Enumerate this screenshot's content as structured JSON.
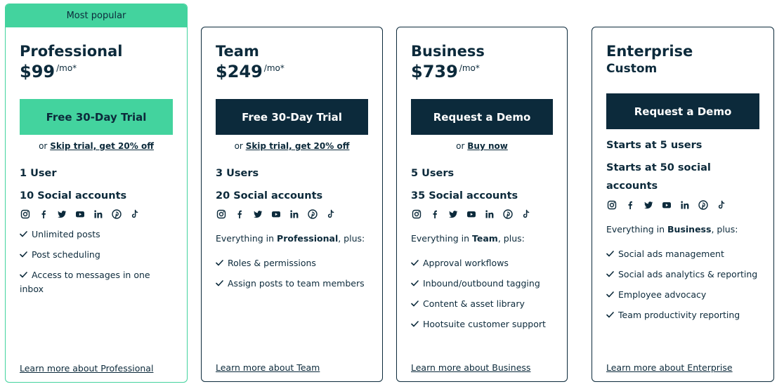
{
  "colors": {
    "brand_green": "#43d39e",
    "navy": "#0c2a3b",
    "white": "#ffffff"
  },
  "plans": {
    "professional": {
      "badge": "Most popular",
      "name": "Professional",
      "price": "$99",
      "per": "/mo*",
      "cta": "Free 30-Day Trial",
      "alt_prefix": "or",
      "alt_link": "Skip trial, get 20% off",
      "users": "1 User",
      "accounts": "10 Social accounts",
      "features": [
        "Unlimited posts",
        "Post scheduling",
        "Access to messages in one inbox"
      ],
      "learn_more": "Learn more about Professional"
    },
    "team": {
      "name": "Team",
      "price": "$249",
      "per": "/mo*",
      "cta": "Free 30-Day Trial",
      "alt_prefix": "or",
      "alt_link": "Skip trial, get 20% off",
      "users": "3 Users",
      "accounts": "20 Social accounts",
      "plus_prefix": "Everything in",
      "plus_plan": "Professional",
      "plus_suffix": ", plus:",
      "features": [
        "Roles & permissions",
        "Assign posts to team members"
      ],
      "learn_more": "Learn more about Team"
    },
    "business": {
      "name": "Business",
      "price": "$739",
      "per": "/mo*",
      "cta": "Request a Demo",
      "alt_prefix": "or",
      "alt_link": "Buy now",
      "users": "5 Users",
      "accounts": "35 Social accounts",
      "plus_prefix": "Everything in",
      "plus_plan": "Team",
      "plus_suffix": ", plus:",
      "features": [
        "Approval workflows",
        "Inbound/outbound tagging",
        "Content & asset library",
        "Hootsuite customer support"
      ],
      "learn_more": "Learn more about Business"
    },
    "enterprise": {
      "name": "Enterprise",
      "subtitle": "Custom",
      "cta": "Request a Demo",
      "users": "Starts at 5 users",
      "accounts": "Starts at 50 social accounts",
      "plus_prefix": "Everything in",
      "plus_plan": "Business",
      "plus_suffix": ", plus:",
      "features": [
        "Social ads management",
        "Social ads analytics & reporting",
        "Employee advocacy",
        "Team productivity reporting"
      ],
      "learn_more": "Learn more about Enterprise"
    }
  },
  "social_icons": [
    "instagram-icon",
    "facebook-icon",
    "twitter-icon",
    "youtube-icon",
    "linkedin-icon",
    "pinterest-icon",
    "tiktok-icon"
  ]
}
